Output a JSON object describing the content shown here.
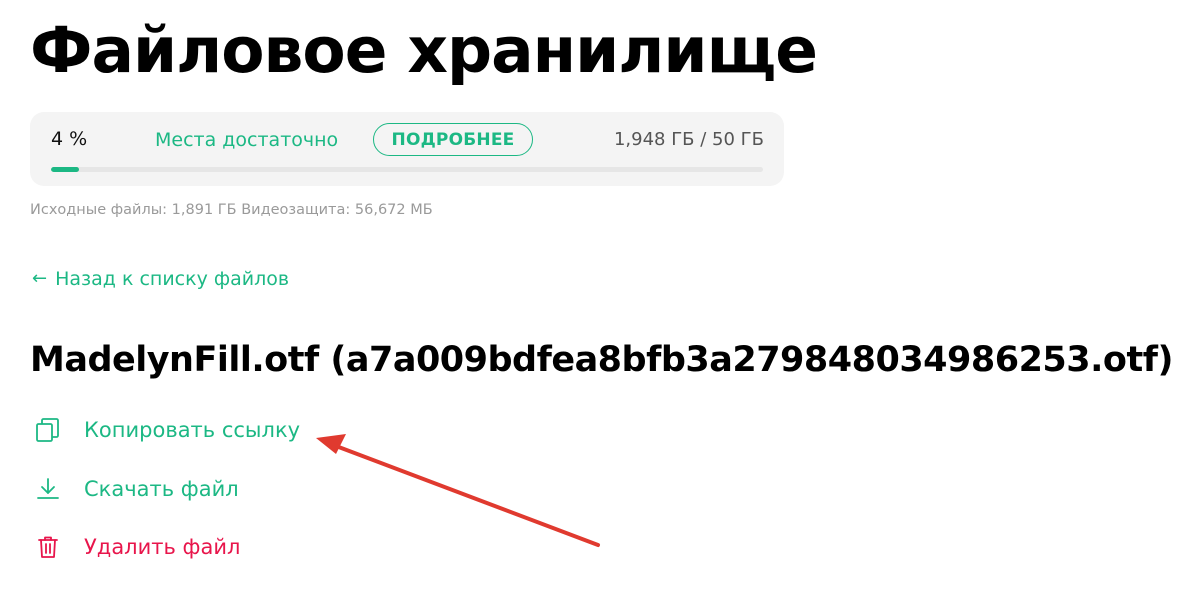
{
  "page": {
    "title": "Файловое хранилище"
  },
  "storage": {
    "percent_label": "4 %",
    "status_text": "Места достаточно",
    "more_button": "ПОДРОБНЕЕ",
    "usage": "1,948 ГБ / 50 ГБ",
    "progress_fraction": 0.04,
    "breakdown": "Исходные файлы: 1,891 ГБ Видеозащита: 56,672 МБ"
  },
  "nav": {
    "back_arrow": "←",
    "back_label": "Назад к списку файлов"
  },
  "file": {
    "title": "MadelynFill.otf (a7a009bdfea8bfb3a279848034986253.otf)"
  },
  "actions": {
    "copy_label": "Копировать ссылку",
    "download_label": "Скачать файл",
    "delete_label": "Удалить файл"
  },
  "colors": {
    "accent": "#1cb884",
    "danger": "#e8154b",
    "annotation": "#e03a2f"
  },
  "icons": {
    "copy": "copy-icon",
    "download": "download-icon",
    "delete": "trash-icon"
  }
}
